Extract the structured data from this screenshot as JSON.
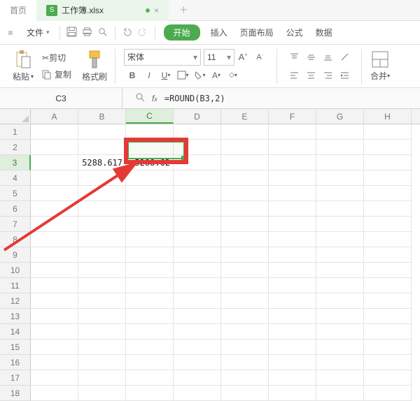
{
  "tabs": {
    "home": "首页",
    "doc_icon": "S",
    "doc_name": "工作簿.xlsx",
    "close": "×",
    "new": "+"
  },
  "menubar": {
    "hamburger": "≡",
    "file": "文件",
    "file_caret": "▾",
    "start": "开始",
    "insert": "插入",
    "page_layout": "页面布局",
    "formula": "公式",
    "data": "数据"
  },
  "ribbon": {
    "paste": "粘贴",
    "paste_caret": "▾",
    "cut": "剪切",
    "cut_icon": "✂",
    "copy": "复制",
    "format_painter": "格式刷",
    "font_name": "宋体",
    "font_size": "11",
    "merge": "合并",
    "merge_caret": "▾"
  },
  "namebox": {
    "cell_ref": "C3",
    "formula": "=ROUND(B3,2)"
  },
  "grid": {
    "columns": [
      "A",
      "B",
      "C",
      "D",
      "E",
      "F",
      "G",
      "H"
    ],
    "active_col": "C",
    "active_row": 3,
    "row_count": 18,
    "cells": {
      "B3": "5288.617",
      "C3": "5288.62"
    }
  }
}
